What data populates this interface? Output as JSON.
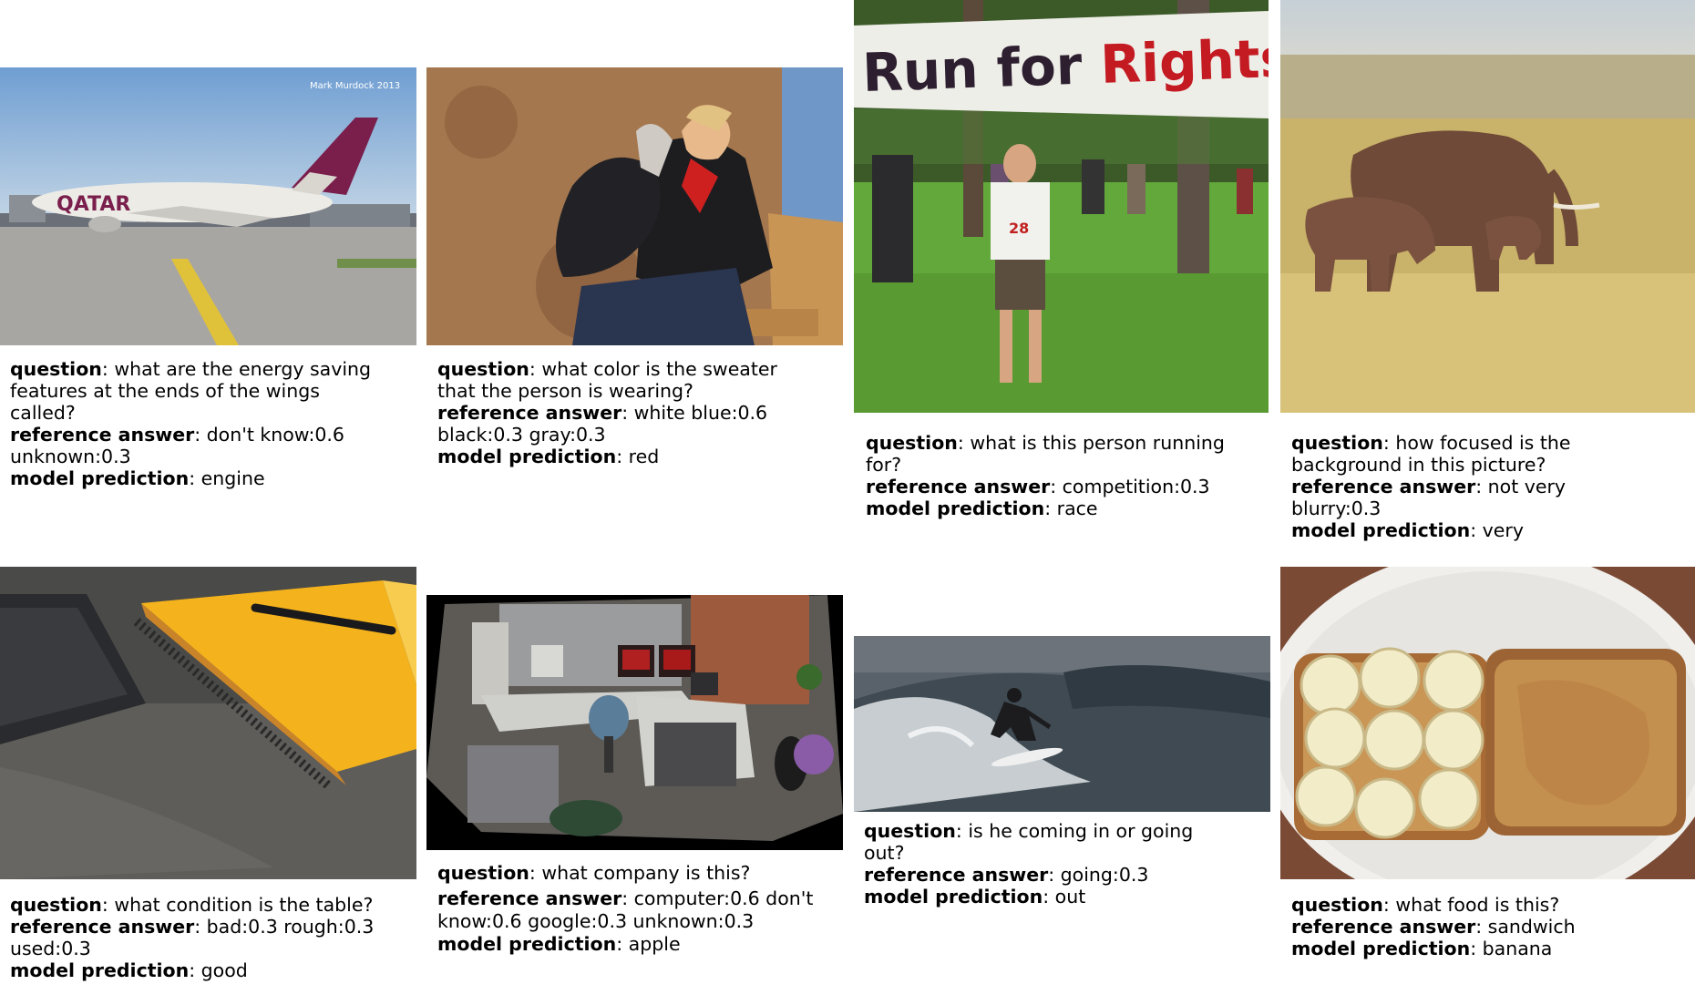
{
  "labels": {
    "question": "question",
    "reference": "reference answer",
    "prediction": "model prediction"
  },
  "examples": [
    {
      "image_desc": "airplane-on-runway",
      "watermark": "Mark Murdock 2013",
      "airline_text": "QATAR",
      "question": "what are the energy saving features at the ends of the wings called?",
      "reference_answer": "don't know:0.6 unknown:0.3",
      "model_prediction": "engine"
    },
    {
      "image_desc": "woman-with-dog-on-bench",
      "question": "what color is the sweater that the person is wearing?",
      "reference_answer": "white blue:0.6 black:0.3 gray:0.3",
      "model_prediction": "red"
    },
    {
      "image_desc": "runner-under-banner",
      "banner_text_1": "Run for ",
      "banner_text_2": "Rights",
      "shirt_number": "28",
      "question": "what is this person running for?",
      "reference_answer": "competition:0.3",
      "model_prediction": "race"
    },
    {
      "image_desc": "elephants-in-grassland",
      "question": "how focused is the background in this picture?",
      "reference_answer": "not very blurry:0.3",
      "model_prediction": "very"
    },
    {
      "image_desc": "notebook-on-table",
      "question": "what condition is the table?",
      "reference_answer": "bad:0.3 rough:0.3 used:0.3",
      "model_prediction": "good"
    },
    {
      "image_desc": "office-cubicle",
      "question": "what company is this?",
      "reference_answer": "computer:0.6 don't know:0.6 google:0.3 unknown:0.3",
      "model_prediction": "apple"
    },
    {
      "image_desc": "surfer-on-wave",
      "question": "is he coming in or going out?",
      "reference_answer": "going:0.3",
      "model_prediction": "out"
    },
    {
      "image_desc": "banana-peanut-butter-toast",
      "question": "what food is this?",
      "reference_answer": "sandwich",
      "model_prediction": "banana"
    }
  ]
}
